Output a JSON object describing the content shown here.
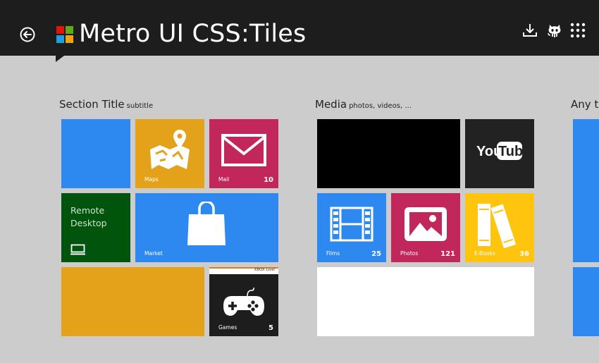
{
  "header": {
    "title": "Metro UI CSS:Tiles",
    "icons": [
      "back-arrow-icon",
      "windows-logo-icon",
      "download-icon",
      "github-octocat-icon",
      "apps-grid-icon"
    ]
  },
  "sections": [
    {
      "title": "Section Title",
      "subtitle": "subtitle",
      "tiles": [
        {
          "name": "blank-blue",
          "color": "#2d89ef"
        },
        {
          "name": "maps",
          "label": "Maps",
          "color": "#e3a21a",
          "icon": "map-pin-icon"
        },
        {
          "name": "mail",
          "label": "Mail",
          "badge": "10",
          "color": "#c1275a",
          "icon": "envelope-icon"
        },
        {
          "name": "remote-desktop",
          "text": "Remote Desktop",
          "color": "#00540c",
          "icon": "monitor-icon"
        },
        {
          "name": "market",
          "label": "Market",
          "color": "#2d89ef",
          "icon": "shopping-bag-icon"
        },
        {
          "name": "blank-orange",
          "color": "#e3a21a"
        },
        {
          "name": "games",
          "label": "Games",
          "badge": "5",
          "color": "#1d1d1d",
          "icon": "gamepad-icon",
          "strip_text": "XBOX Live!"
        }
      ]
    },
    {
      "title": "Media",
      "subtitle": "photos, videos, ...",
      "tiles": [
        {
          "name": "video-black",
          "color": "#000000"
        },
        {
          "name": "youtube",
          "color": "#222222",
          "icon": "youtube-logo-icon",
          "logo_left": "You",
          "logo_right": "Tube"
        },
        {
          "name": "films",
          "label": "Films",
          "badge": "25",
          "color": "#2d89ef",
          "icon": "film-strip-icon"
        },
        {
          "name": "photos",
          "label": "Photos",
          "badge": "121",
          "color": "#c1275a",
          "icon": "picture-icon"
        },
        {
          "name": "ebooks",
          "label": "E-Books",
          "badge": "36",
          "color": "#ffc40d",
          "icon": "books-icon"
        },
        {
          "name": "blank-white",
          "color": "#ffffff"
        }
      ]
    },
    {
      "title": "Any t",
      "tiles": [
        {
          "name": "partial-blue-1",
          "color": "#2d89ef"
        },
        {
          "name": "partial-blue-2",
          "color": "#2d89ef"
        }
      ]
    }
  ]
}
